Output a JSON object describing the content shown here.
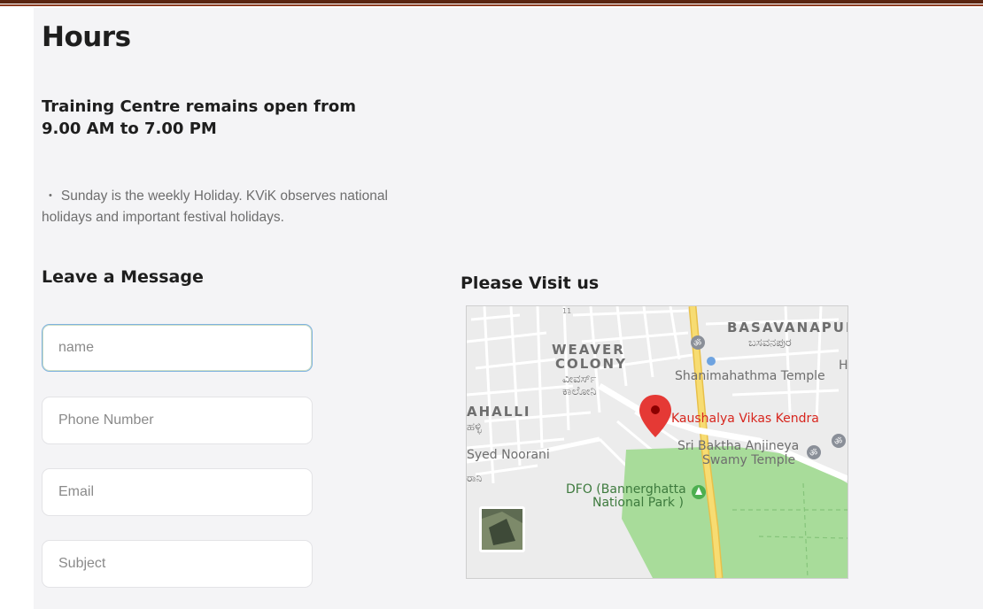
{
  "hours": {
    "title": "Hours",
    "open_line1": "Training Centre remains open from",
    "open_line2": "9.00 AM to 7.00 PM",
    "holiday_bullet": "•",
    "holiday_text": "Sunday is the weekly Holiday. KViK observes national holidays and important festival holidays."
  },
  "form": {
    "title": "Leave a Message",
    "fields": [
      {
        "placeholder": "name",
        "value": ""
      },
      {
        "placeholder": "Phone Number",
        "value": ""
      },
      {
        "placeholder": "Email",
        "value": ""
      },
      {
        "placeholder": "Subject",
        "value": ""
      }
    ]
  },
  "map": {
    "title": "Please Visit us",
    "labels": {
      "basavanapura": "BASAVANAPUI",
      "basavanapura_kn": "ಬಸವನಪುರ",
      "weaver1": "WEAVER",
      "weaver2": "COLONY",
      "weaver_kn1": "ವೀವರ್ಸ್",
      "weaver_kn2": "ಕಾಲೋನಿ",
      "temple": "Shanimahathma Temple",
      "h_letter": "H",
      "halli": "AHALLI",
      "halli_kn": "ಹಳ್ಳಿ",
      "kendra": "Kaushalya Vikas Kendra",
      "anjineya1": "Sri Baktha Anjineya",
      "anjineya2": "Swamy Temple",
      "syed": "Syed Noorani",
      "syed_kn": "ರಾನಿ",
      "dfo1": "DFO (Bannerghatta",
      "dfo2": "National Park )",
      "road_num": "11"
    },
    "colors": {
      "marker": "#e53935",
      "park": "#a8dc9a",
      "road": "#f4d25e"
    }
  }
}
